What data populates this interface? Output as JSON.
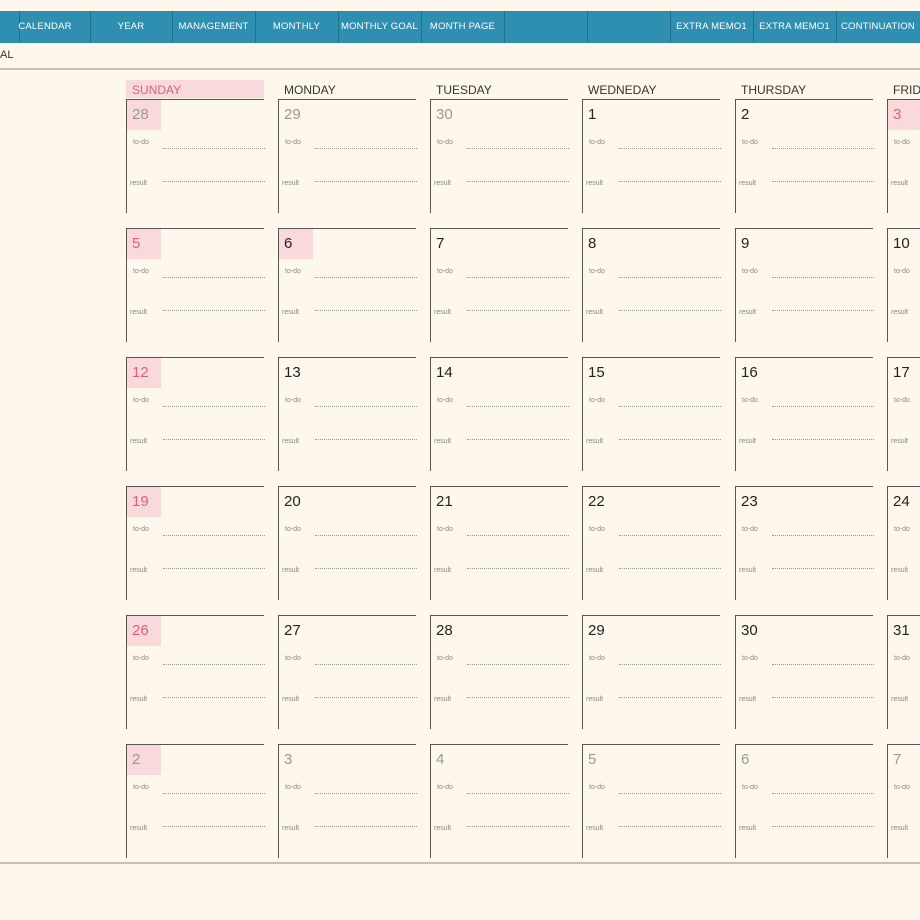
{
  "nav": {
    "tabs": [
      "CALENDAR",
      "YEAR",
      "MANAGEMENT",
      "MONTHLY",
      "MONTHLY GOAL",
      "MONTH PAGE",
      "",
      "EXTRA MEMO1",
      "EXTRA MEMO1",
      "CONTINUATION"
    ]
  },
  "page": {
    "subtitle": "AL"
  },
  "calendar": {
    "days": [
      "SUNDAY",
      "MONDAY",
      "TUESDAY",
      "WEDNEDAY",
      "THURSDAY",
      "FRIDAY"
    ],
    "todo_label": "to-do",
    "result_label": "result",
    "weeks": [
      [
        {
          "n": "28",
          "c": "grey",
          "hl": true
        },
        {
          "n": "29",
          "c": "grey"
        },
        {
          "n": "30",
          "c": "grey"
        },
        {
          "n": "1"
        },
        {
          "n": "2"
        },
        {
          "n": "3",
          "c": "red",
          "hl": true
        }
      ],
      [
        {
          "n": "5",
          "c": "red",
          "hl": true
        },
        {
          "n": "6",
          "hl": true
        },
        {
          "n": "7"
        },
        {
          "n": "8"
        },
        {
          "n": "9"
        },
        {
          "n": "10"
        }
      ],
      [
        {
          "n": "12",
          "c": "red",
          "hl": true
        },
        {
          "n": "13"
        },
        {
          "n": "14"
        },
        {
          "n": "15"
        },
        {
          "n": "16"
        },
        {
          "n": "17"
        }
      ],
      [
        {
          "n": "19",
          "c": "red",
          "hl": true
        },
        {
          "n": "20"
        },
        {
          "n": "21"
        },
        {
          "n": "22"
        },
        {
          "n": "23"
        },
        {
          "n": "24"
        }
      ],
      [
        {
          "n": "26",
          "c": "red",
          "hl": true
        },
        {
          "n": "27"
        },
        {
          "n": "28"
        },
        {
          "n": "29"
        },
        {
          "n": "30"
        },
        {
          "n": "31"
        }
      ],
      [
        {
          "n": "2",
          "c": "grey",
          "hl": true
        },
        {
          "n": "3",
          "c": "grey"
        },
        {
          "n": "4",
          "c": "grey"
        },
        {
          "n": "5",
          "c": "grey"
        },
        {
          "n": "6",
          "c": "grey"
        },
        {
          "n": "7",
          "c": "grey"
        }
      ]
    ]
  }
}
